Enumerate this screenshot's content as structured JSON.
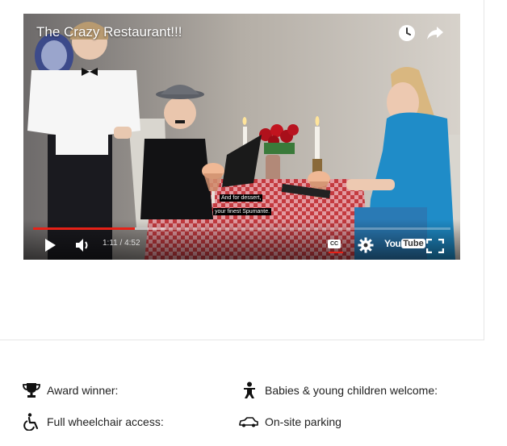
{
  "video": {
    "title": "The Crazy Restaurant!!!",
    "current_time": "1:11",
    "duration": "4:52",
    "time_display": "1:11 / 4:52",
    "progress_fraction": 0.243,
    "captions": [
      "And for dessert,",
      "your finest Spumante."
    ],
    "icons": {
      "watch_later": "clock-icon",
      "share": "share-icon",
      "play": "play-icon",
      "volume": "volume-icon",
      "captions": "cc-icon",
      "settings": "gear-icon",
      "youtube": "youtube-logo",
      "fullscreen": "fullscreen-icon"
    },
    "cc_label": "CC",
    "youtube_label": "YouTube",
    "accent_color": "#e62117"
  },
  "features": [
    {
      "icon": "trophy-icon",
      "label": "Award winner:"
    },
    {
      "icon": "baby-icon",
      "label": "Babies & young children welcome:"
    },
    {
      "icon": "wheelchair-icon",
      "label": "Full wheelchair access:"
    },
    {
      "icon": "car-icon",
      "label": "On-site parking"
    }
  ]
}
